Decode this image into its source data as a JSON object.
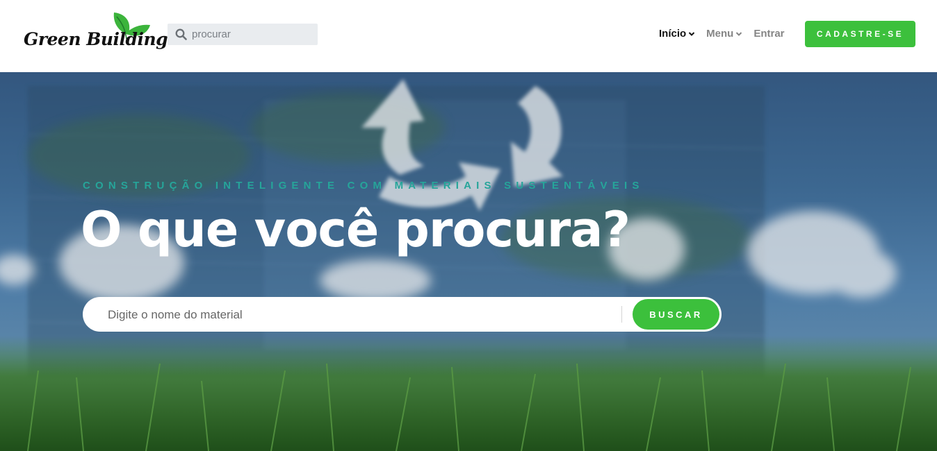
{
  "brand": {
    "logo_text": "Green Building",
    "accent": "#3cc03c"
  },
  "header": {
    "search_placeholder": "procurar",
    "nav": [
      {
        "label": "Início",
        "active": true,
        "has_dropdown": true
      },
      {
        "label": "Menu",
        "active": false,
        "has_dropdown": true
      },
      {
        "label": "Entrar",
        "active": false,
        "has_dropdown": false
      }
    ],
    "signup_label": "CADASTRE-SE"
  },
  "hero": {
    "tagline": "CONSTRUÇÃO INTELIGENTE COM MATERIAIS SUSTENTÁVEIS",
    "headline": "O que você procura?",
    "search_placeholder": "Digite o nome do material",
    "search_button": "BUSCAR"
  },
  "icons": {
    "search": "search-icon",
    "chevron": "chevron-down-icon",
    "leaf": "leaf-icon",
    "recycle": "recycle-icon"
  },
  "colors": {
    "tagline": "#26a59a",
    "headline": "#ffffff",
    "nav_active": "#111111",
    "nav_inactive": "#858585"
  }
}
